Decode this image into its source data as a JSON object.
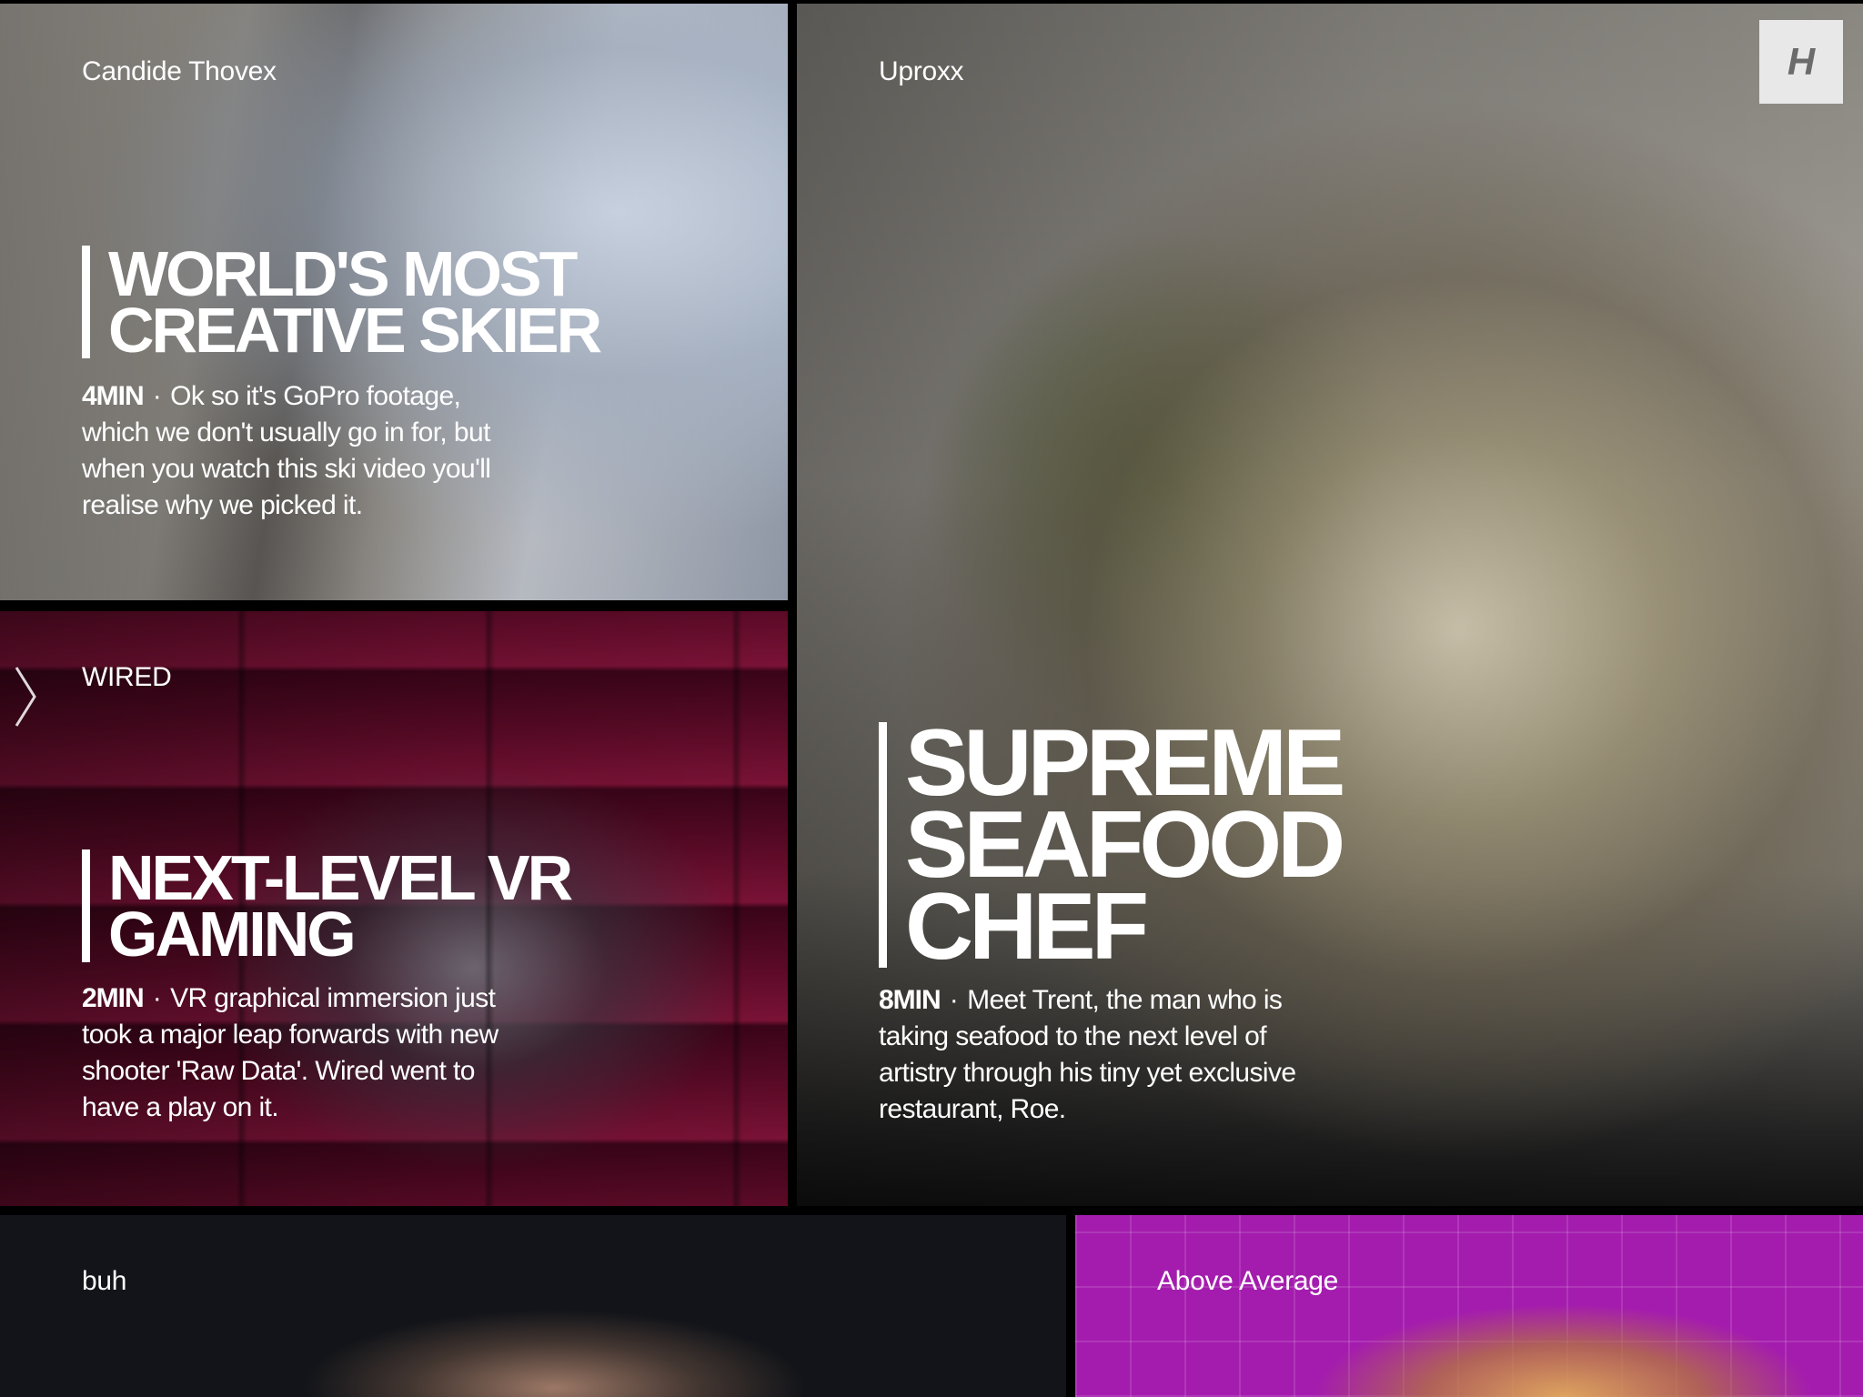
{
  "logo": {
    "letter": "H"
  },
  "tiles": {
    "ski": {
      "source": "Candide Thovex",
      "headline": [
        "WORLD'S MOST",
        "CREATIVE SKIER"
      ],
      "duration": "4MIN",
      "separator": "·",
      "description": [
        "Ok so it's GoPro footage,",
        "which we don't usually go in for, but",
        "when you watch this ski video you'll",
        "realise why we picked it."
      ]
    },
    "vr": {
      "source": "WIRED",
      "headline": [
        "NEXT-LEVEL VR",
        "GAMING"
      ],
      "duration": "2MIN",
      "separator": "·",
      "description": [
        "VR graphical immersion just",
        "took a major leap forwards with new",
        "shooter 'Raw Data'. Wired went to",
        "have a play on it."
      ]
    },
    "seafood": {
      "source": "Uproxx",
      "headline": [
        "SUPREME",
        "SEAFOOD",
        "CHEF"
      ],
      "duration": "8MIN",
      "separator": "·",
      "description": [
        "Meet Trent, the man who is",
        "taking seafood to the next level of",
        "artistry through his tiny yet exclusive",
        "restaurant, Roe."
      ]
    },
    "buh": {
      "source": "buh"
    },
    "average": {
      "source": "Above Average"
    }
  },
  "icons": {
    "logo": "h-logo-icon",
    "nav": "chevron-right-icon"
  }
}
